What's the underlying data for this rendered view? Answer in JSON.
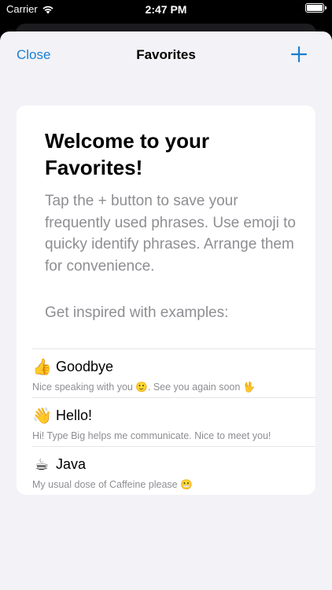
{
  "status_bar": {
    "carrier": "Carrier",
    "time": "2:47 PM"
  },
  "nav": {
    "close_label": "Close",
    "title": "Favorites",
    "add_icon": "plus-icon"
  },
  "welcome": {
    "title": "Welcome to your Favorites!",
    "body": "Tap the + button to save your frequently used phrases. Use emoji to quicky identify phrases. Arrange them for convenience.",
    "inspire": "Get inspired with examples:"
  },
  "examples": [
    {
      "emoji": "👍",
      "title": "Goodbye",
      "subtitle": "Nice speaking with you 🙂. See you again soon 🖖"
    },
    {
      "emoji": "👋",
      "title": "Hello!",
      "subtitle": "Hi! Type Big helps me communicate. Nice to meet you!"
    },
    {
      "emoji": "☕",
      "title": "Java",
      "subtitle": "My usual dose of Caffeine please 😬"
    }
  ],
  "colors": {
    "accent": "#1a7fd0",
    "sheet_bg": "#f2f2f7",
    "secondary_text": "#8e8e93"
  }
}
